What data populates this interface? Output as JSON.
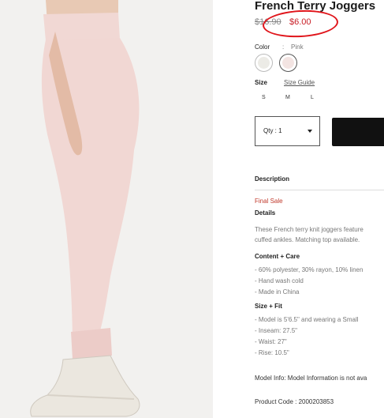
{
  "product": {
    "title": "French Terry Joggers",
    "price_original": "$16.90",
    "price_sale": "$6.00"
  },
  "color": {
    "label": "Color",
    "separator": ":",
    "selected": "Pink",
    "swatches": [
      {
        "name": "Cream",
        "hex": "#ecebe6"
      },
      {
        "name": "Pink",
        "hex": "#f3e4e2"
      }
    ]
  },
  "size": {
    "label": "Size",
    "guide_label": "Size Guide",
    "options": [
      "S",
      "M",
      "L"
    ]
  },
  "quantity": {
    "label": "Qty : 1"
  },
  "description": {
    "title": "Description",
    "final_sale": "Final Sale",
    "details_title": "Details",
    "details_lines": [
      "These French terry knit joggers feature",
      "cuffed ankles. Matching top available."
    ],
    "content_title": "Content + Care",
    "content_items": [
      "- 60% polyester, 30% rayon, 10% linen",
      "- Hand wash cold",
      "- Made in China"
    ],
    "fit_title": "Size + Fit",
    "fit_items": [
      "- Model is 5'6.5\" and wearing a Small",
      "- Inseam: 27.5\"",
      "- Waist: 27\"",
      "- Rise: 10.5\""
    ],
    "model_info": "Model Info: Model Information is not ava",
    "product_code": "Product Code : 2000203853"
  },
  "annotation": {
    "color": "#e0151b"
  }
}
